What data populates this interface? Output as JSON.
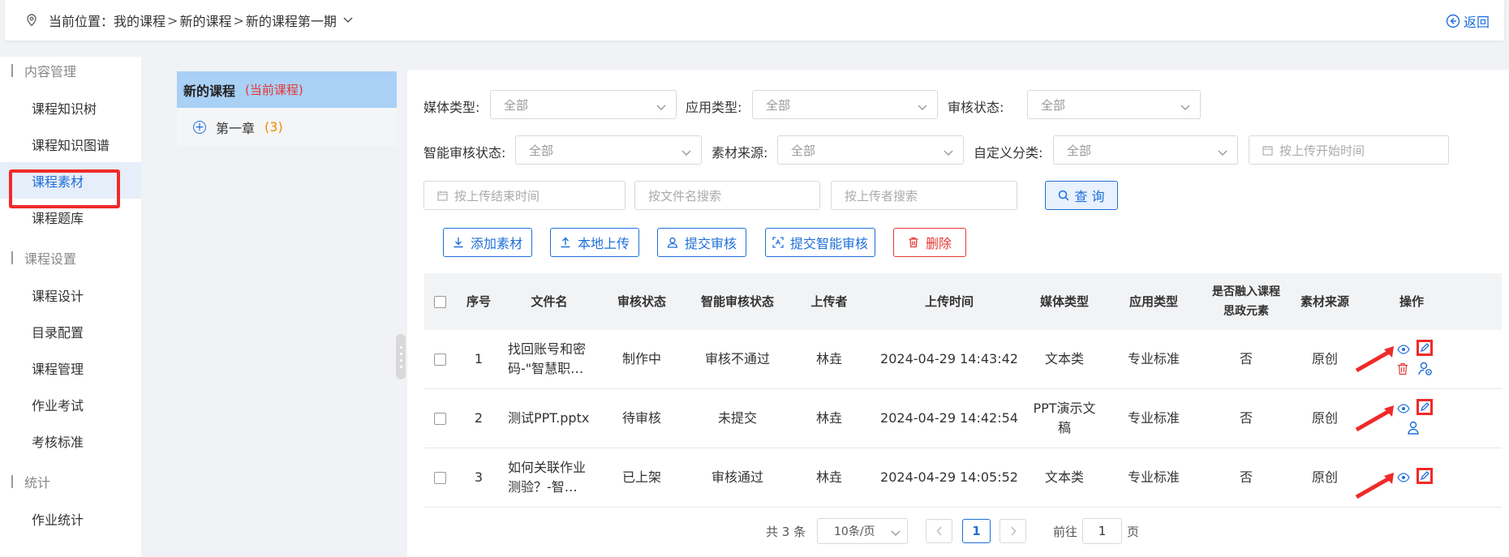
{
  "breadcrumb": {
    "prefix": "当前位置：",
    "items": [
      "我的课程",
      "新的课程",
      "新的课程第一期"
    ],
    "separator": ">",
    "back_label": "返回"
  },
  "sidebar": {
    "groups": [
      {
        "title": "内容管理",
        "items": [
          "课程知识树",
          "课程知识图谱",
          "课程素材",
          "课程题库"
        ]
      },
      {
        "title": "课程设置",
        "items": [
          "课程设计",
          "目录配置",
          "课程管理",
          "作业考试",
          "考核标准"
        ]
      },
      {
        "title": "统计",
        "items": [
          "作业统计"
        ]
      }
    ],
    "active_item": "课程素材"
  },
  "tree": {
    "course_name": "新的课程",
    "current_tag": "(当前课程)",
    "chapter_label": "第一章",
    "chapter_count": "(3)"
  },
  "filters": {
    "media_type_label": "媒体类型:",
    "media_type_value": "全部",
    "app_type_label": "应用类型:",
    "app_type_value": "全部",
    "audit_status_label": "审核状态:",
    "audit_status_value": "全部",
    "ai_audit_label": "智能审核状态:",
    "ai_audit_value": "全部",
    "source_label": "素材来源:",
    "source_value": "全部",
    "custom_label": "自定义分类:",
    "custom_value": "全部",
    "start_time_placeholder": "按上传开始时间",
    "end_time_placeholder": "按上传结束时间",
    "filename_placeholder": "按文件名搜索",
    "uploader_placeholder": "按上传者搜索",
    "query_label": "查 询"
  },
  "actions": {
    "add": "添加素材",
    "local_upload": "本地上传",
    "submit_audit": "提交审核",
    "submit_ai_audit": "提交智能审核",
    "delete": "删除"
  },
  "table": {
    "headers": {
      "no": "序号",
      "name": "文件名",
      "audit": "审核状态",
      "ai_audit": "智能审核状态",
      "uploader": "上传者",
      "time": "上传时间",
      "media": "媒体类型",
      "app": "应用类型",
      "ideo_1": "是否融入课程",
      "ideo_2": "思政元素",
      "source": "素材来源",
      "op": "操作"
    },
    "rows": [
      {
        "no": "1",
        "name": "找回账号和密码-\"智慧职…",
        "audit": "制作中",
        "ai_audit": "审核不通过",
        "uploader": "林垚",
        "time": "2024-04-29 14:43:42",
        "media": "文本类",
        "app": "专业标准",
        "ideo": "否",
        "source": "原创"
      },
      {
        "no": "2",
        "name": "测试PPT.pptx",
        "audit": "待审核",
        "ai_audit": "未提交",
        "uploader": "林垚",
        "time": "2024-04-29 14:42:54",
        "media": "PPT演示文稿",
        "app": "专业标准",
        "ideo": "否",
        "source": "原创"
      },
      {
        "no": "3",
        "name": "如何关联作业测验？-智…",
        "audit": "已上架",
        "ai_audit": "审核通过",
        "uploader": "林垚",
        "time": "2024-04-29 14:05:52",
        "media": "文本类",
        "app": "专业标准",
        "ideo": "否",
        "source": "原创"
      }
    ]
  },
  "pagination": {
    "total": "共 3 条",
    "page_size": "10条/页",
    "current": "1",
    "goto_prefix": "前往",
    "goto_value": "1",
    "goto_suffix": "页"
  },
  "colors": {
    "primary": "#1e6fd9",
    "danger": "#e53935",
    "highlight_red": "#f02a2a",
    "tree_header_bg": "#a9d0f5",
    "count_orange": "#f08c00"
  }
}
